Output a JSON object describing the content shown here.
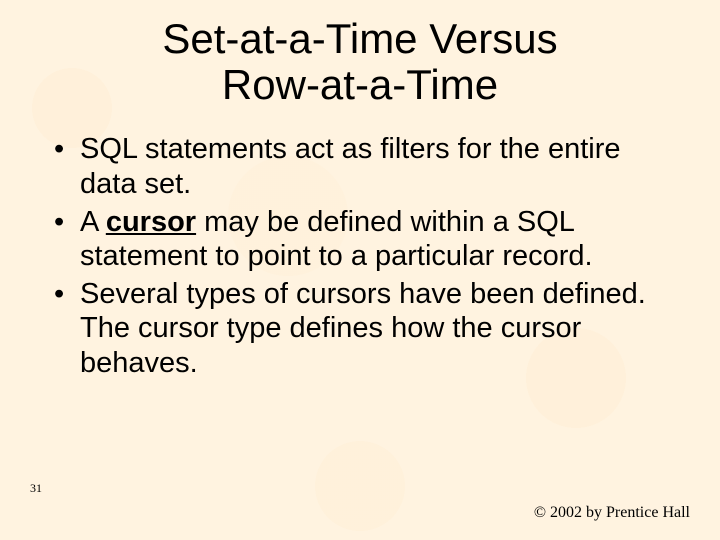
{
  "title_line1": "Set-at-a-Time Versus",
  "title_line2": "Row-at-a-Time",
  "bullets": [
    {
      "pre": "SQL statements act as filters for the entire data set.",
      "emph": "",
      "post": ""
    },
    {
      "pre": "A ",
      "emph": "cursor",
      "post": " may be defined within a SQL statement to point to a particular record."
    },
    {
      "pre": "Several types of cursors have been defined.  The cursor type defines how the cursor behaves.",
      "emph": "",
      "post": ""
    }
  ],
  "page_number": "31",
  "copyright": "© 2002 by Prentice Hall"
}
